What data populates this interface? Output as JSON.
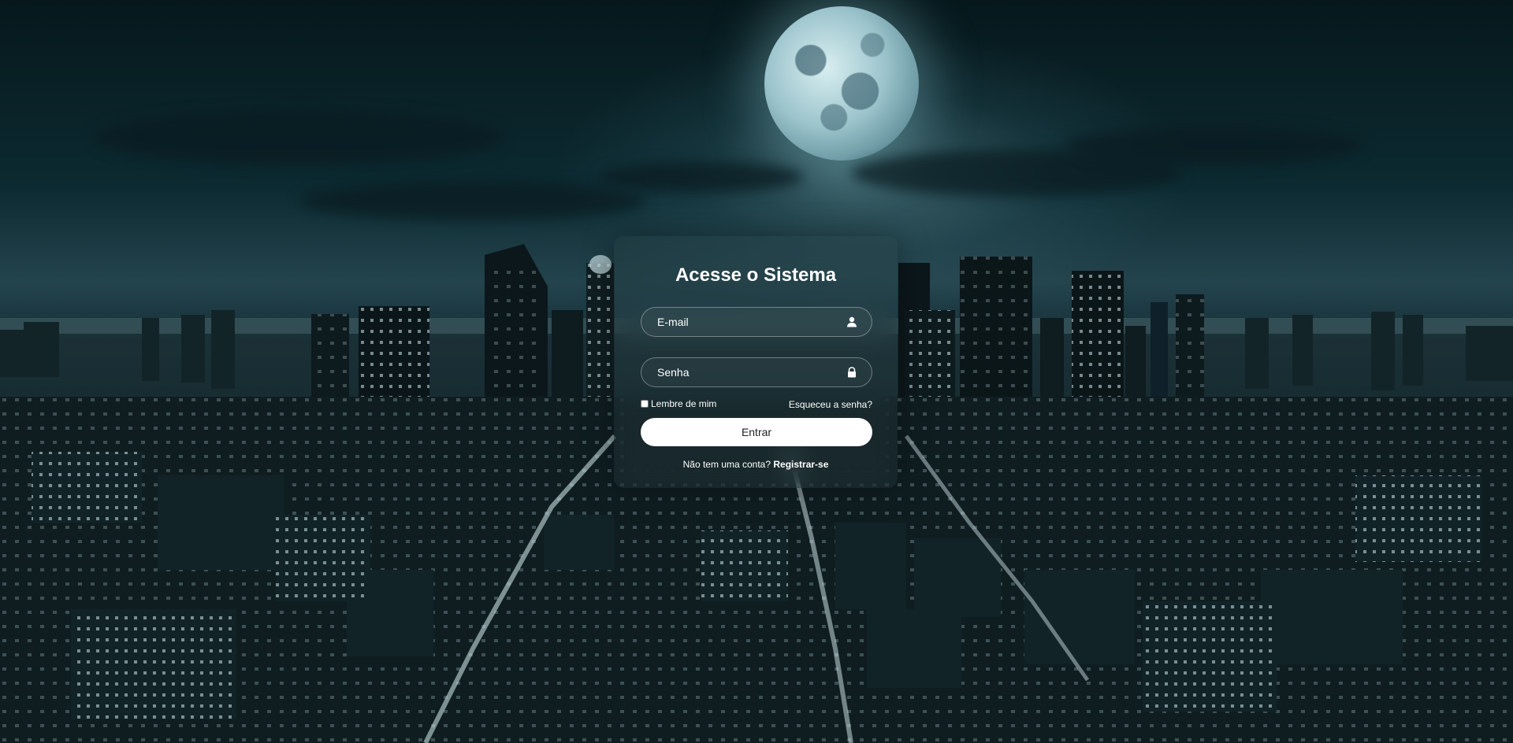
{
  "login": {
    "title": "Acesse o Sistema",
    "email_placeholder": "E-mail",
    "password_placeholder": "Senha",
    "remember_label": "Lembre de mim",
    "forgot_link": "Esqueceu a senha?",
    "submit_label": "Entrar",
    "register_prompt": "Não tem uma conta?",
    "register_link": "Registrar-se",
    "email_icon": "user-icon",
    "password_icon": "lock-icon"
  },
  "background": {
    "description_icon": "night-city-moon-background",
    "accent": "#ffffff",
    "sky_color": "#0c2a31"
  }
}
